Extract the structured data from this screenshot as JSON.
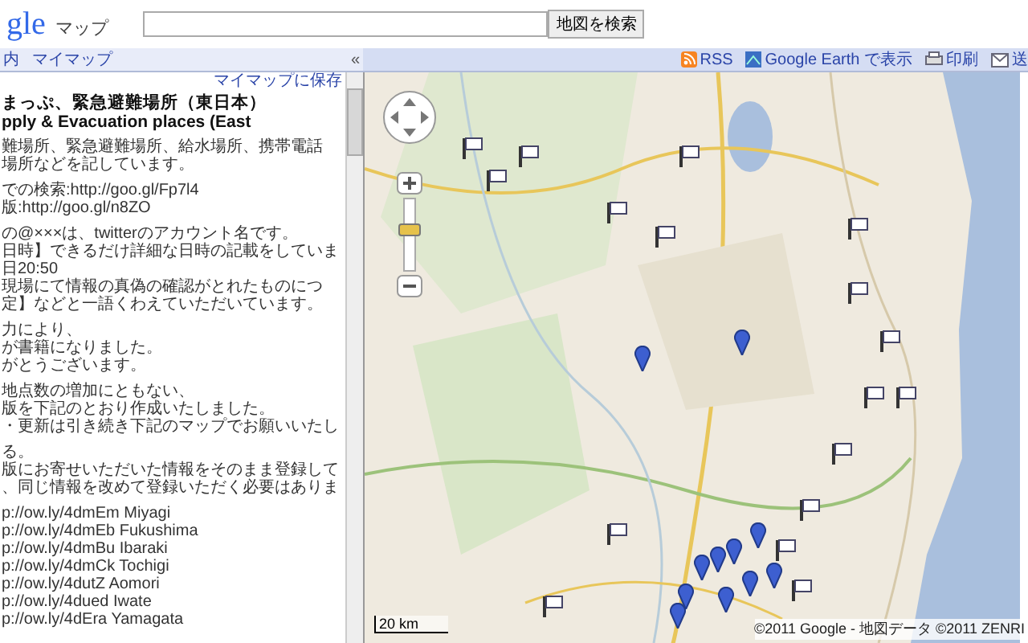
{
  "header": {
    "logo": "gle",
    "product": "マップ",
    "search_button": "地図を検索"
  },
  "panel_links": [
    "内",
    "マイマップ"
  ],
  "collapse": "«",
  "toolbar": [
    {
      "kind": "rss",
      "label": "RSS"
    },
    {
      "kind": "earth",
      "label": "Google Earth で表示"
    },
    {
      "kind": "print",
      "label": "印刷"
    },
    {
      "kind": "send",
      "label": "送"
    }
  ],
  "panel": {
    "save_link": "マイマップに保存",
    "title_lines": [
      "まっぷ、緊急避難場所（東日本）",
      "pply & Evacuation places (East"
    ],
    "paragraphs": [
      [
        "難場所、緊急避難場所、給水場所、携帯電話",
        "場所などを記しています。"
      ],
      [
        "での検索:http://goo.gl/Fp7l4",
        "版:http://goo.gl/n8ZO"
      ],
      [
        "の@×××は、twitterのアカウント名です。",
        "日時】できるだけ詳細な日時の記載をしていま",
        "日20:50",
        "現場にて情報の真偽の確認がとれたものにつ",
        "定】などと一語くわえていただいています。"
      ],
      [
        "力により、",
        "が書籍になりました。",
        "がとうございます。"
      ],
      [
        "地点数の増加にともない、",
        "版を下記のとおり作成いたしました。",
        "・更新は引き続き下記のマップでお願いいたし"
      ],
      [
        "る。",
        "版にお寄せいただいた情報をそのまま登録して",
        "、同じ情報を改めて登録いただく必要はありま"
      ]
    ],
    "links": [
      "p://ow.ly/4dmEm Miyagi",
      "p://ow.ly/4dmEb Fukushima",
      "p://ow.ly/4dmBu Ibaraki",
      "p://ow.ly/4dmCk Tochigi",
      "p://ow.ly/4dutZ Aomori",
      "p://ow.ly/4dued Iwate",
      "p://ow.ly/4dEra Yamagata"
    ]
  },
  "map": {
    "zoom": {
      "level": 0.6
    },
    "scale": "20 km",
    "copyright": "©2011 Google - 地図データ ©2011 ZENRI"
  }
}
